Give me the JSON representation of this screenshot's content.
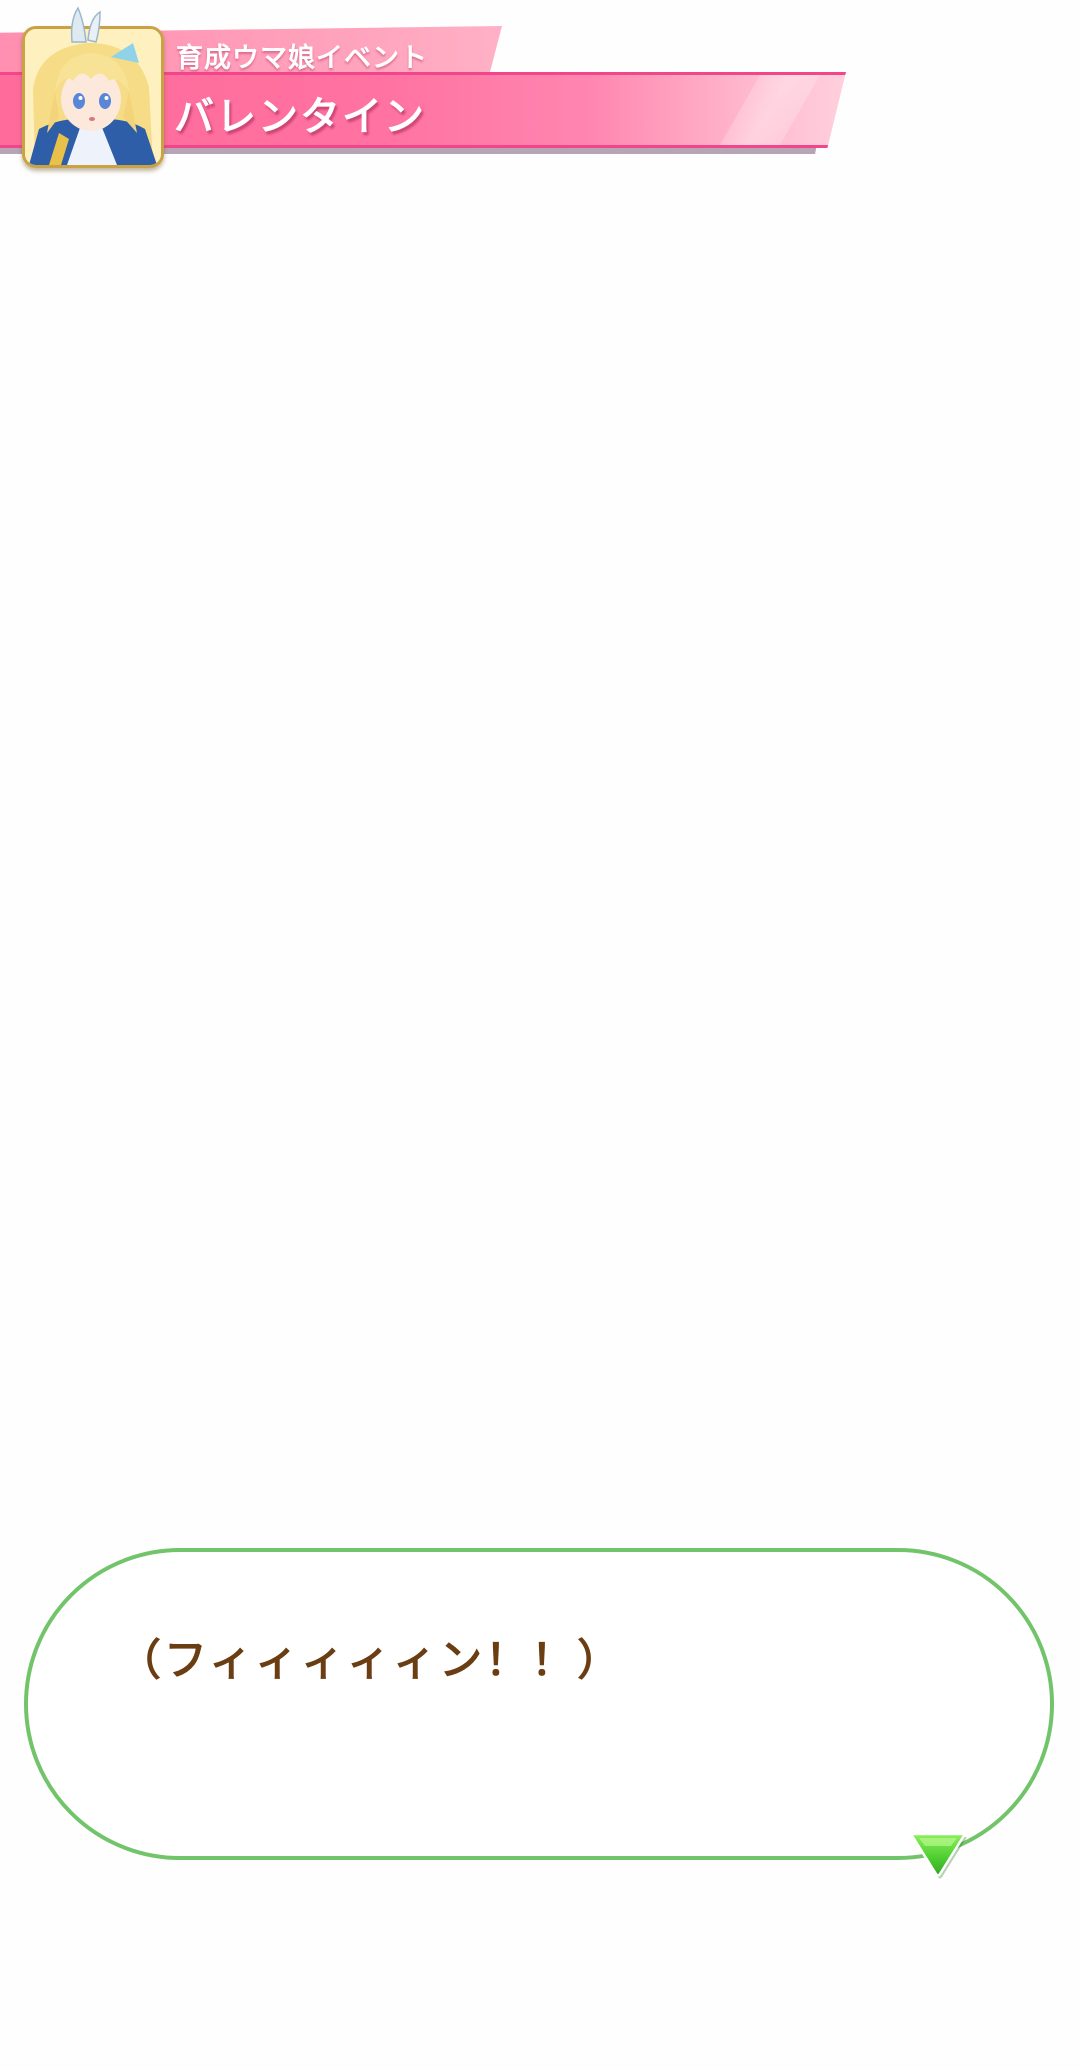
{
  "event_banner": {
    "category": "育成ウマ娘イベント",
    "title": "バレンタイン"
  },
  "dialog": {
    "text": "（フィィィィィン！！）"
  },
  "icons": {
    "portrait": "character-portrait-icon",
    "next": "next-arrow-icon"
  },
  "colors": {
    "banner_pink": "#ff72a1",
    "banner_border": "#f2468a",
    "dialog_border": "#72c46a",
    "dialog_text": "#6b3d12",
    "arrow_green": "#5fd63a"
  }
}
